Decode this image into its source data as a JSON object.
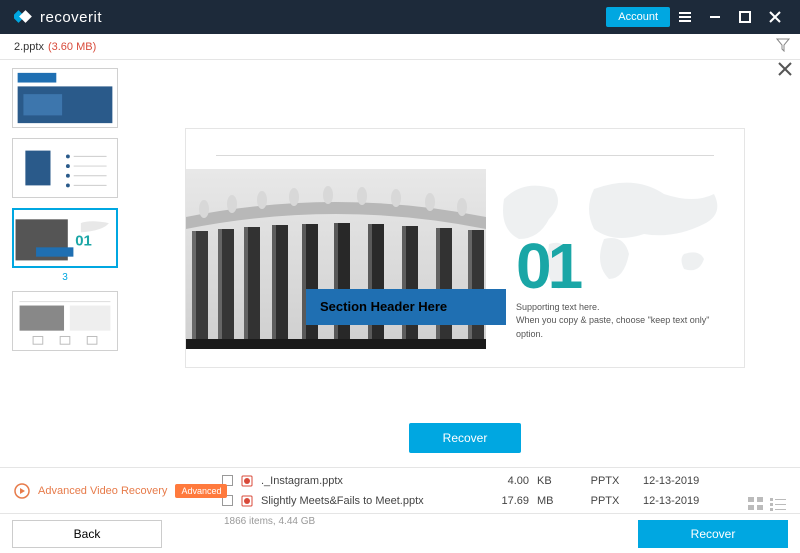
{
  "brand": {
    "name": "recoverit"
  },
  "titlebar": {
    "account_label": "Account"
  },
  "preview": {
    "file_name": "2.pptx",
    "file_size": "(3.60 MB)",
    "selected_thumb_index": "3",
    "slide": {
      "section_header": "Section Header Here",
      "big_number": "01",
      "supporting_line1": "Supporting text here.",
      "supporting_line2": "When you copy & paste, choose \"keep text only\" option."
    },
    "recover_button": "Recover"
  },
  "advanced": {
    "label": "Advanced Video Recovery",
    "badge": "Advanced"
  },
  "files": {
    "rows": [
      {
        "name": "._Instagram.pptx",
        "size": "4.00",
        "unit": "KB",
        "type": "PPTX",
        "date": "12-13-2019"
      },
      {
        "name": "Slightly Meets&Fails to Meet.pptx",
        "size": "17.69",
        "unit": "MB",
        "type": "PPTX",
        "date": "12-13-2019"
      }
    ],
    "summary": "1866 items, 4.44  GB"
  },
  "bottom": {
    "back_label": "Back",
    "recover_label": "Recover"
  }
}
